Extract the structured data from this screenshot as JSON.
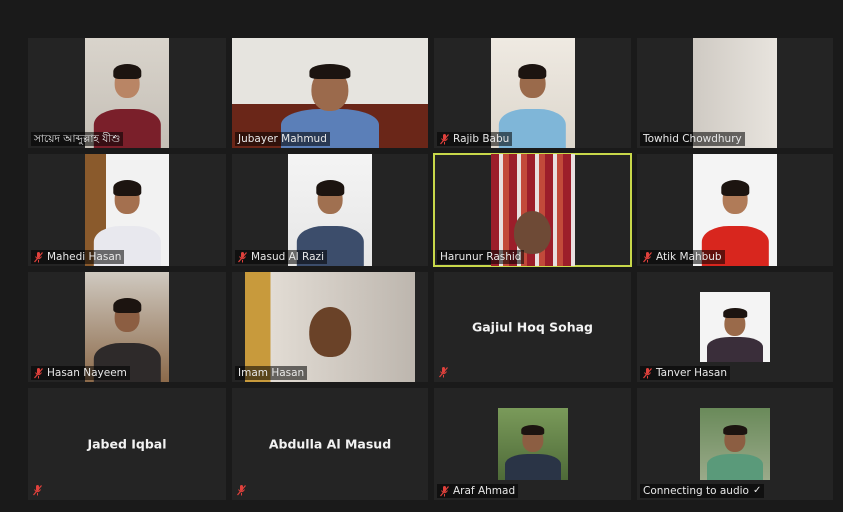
{
  "participants": [
    {
      "name": "সায়েদ আব্দুল্লাহ যীশু",
      "muted": false
    },
    {
      "name": "Jubayer Mahmud",
      "muted": false
    },
    {
      "name": "Rajib Babu",
      "muted": true
    },
    {
      "name": "Towhid Chowdhury",
      "muted": false
    },
    {
      "name": "Mahedi Hasan",
      "muted": true
    },
    {
      "name": "Masud Al Razi",
      "muted": true
    },
    {
      "name": "Harunur Rashid",
      "muted": false,
      "active_speaker": true
    },
    {
      "name": "Atik Mahbub",
      "muted": true
    },
    {
      "name": "Hasan Nayeem",
      "muted": true
    },
    {
      "name": "Imam Hasan",
      "muted": false
    },
    {
      "name": "Gajiul Hoq Sohag",
      "muted": true,
      "video": false
    },
    {
      "name": "Tanver Hasan",
      "muted": true
    },
    {
      "name": "Jabed Iqbal",
      "muted": true,
      "video": false
    },
    {
      "name": "Abdulla Al Masud",
      "muted": true,
      "video": false
    },
    {
      "name": "Araf Ahmad",
      "muted": true
    },
    {
      "name": "Connecting to audio",
      "status_icon": "checkmark-icon"
    }
  ],
  "colors": {
    "background": "#1a1a1a",
    "tile": "#242424",
    "active_speaker_border": "#c8d84a",
    "muted_mic": "#e0413c"
  },
  "icons": {
    "muted": "mic-muted-icon",
    "check": "✓"
  }
}
